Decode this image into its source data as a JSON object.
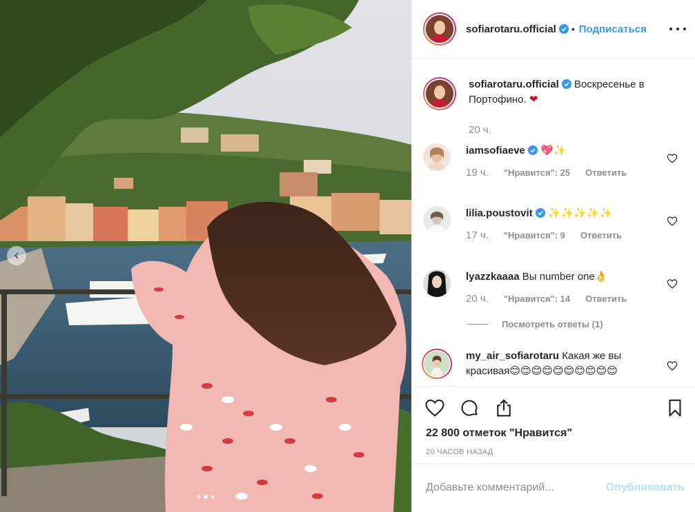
{
  "post": {
    "author": "sofiarotaru.official",
    "follow_label": "Подписаться",
    "caption_text": "Воскресенье в Портофино.",
    "caption_emoji": "❤",
    "caption_time": "20 ч."
  },
  "comments": [
    {
      "user": "iamsofiaeve",
      "verified": true,
      "text": "💖✨",
      "time": "19 ч.",
      "likes": "\"Нравится\": 25",
      "reply": "Ответить"
    },
    {
      "user": "lilia.poustovit",
      "verified": true,
      "text": "✨✨✨✨✨",
      "time": "17 ч.",
      "likes": "\"Нравится\": 9",
      "reply": "Ответить"
    },
    {
      "user": "lyazzkaaaa",
      "verified": false,
      "text": "Вы number one👌",
      "time": "20 ч.",
      "likes": "\"Нравится\": 14",
      "reply": "Ответить",
      "view_replies": "Посмотреть ответы (1)"
    },
    {
      "user": "my_air_sofiarotaru",
      "verified": false,
      "text": "Какая же вы красивая😊😊😊😊😊😊😊😊😊😊"
    }
  ],
  "stats": {
    "likes_count": "22 800 отметок \"Нравится\"",
    "time_ago": "20 ЧАСОВ НАЗАД"
  },
  "compose": {
    "placeholder": "Добавьте комментарий...",
    "publish_label": "Опубликовать"
  },
  "icons": {
    "heart": "heart-icon",
    "comment": "comment-icon",
    "share": "share-icon",
    "save": "bookmark-icon",
    "more": "more-options-icon",
    "verified": "verified-badge-icon",
    "prev": "chevron-left-icon"
  },
  "colors": {
    "accent": "#3897f0",
    "muted": "#8e8e8e",
    "publish_disabled": "#b2dffc",
    "border": "#efefef"
  },
  "carousel": {
    "slide_count": 3,
    "active_slide": 2
  }
}
